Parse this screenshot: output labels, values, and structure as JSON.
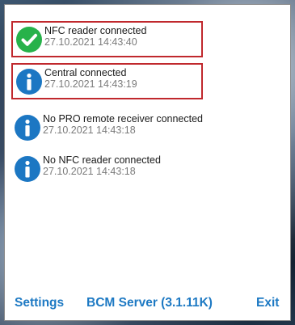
{
  "notifications": [
    {
      "icon": "check-circle-icon",
      "title": "NFC reader connected",
      "time": "27.10.2021 14:43:40",
      "highlighted": true,
      "color": "#27b24a"
    },
    {
      "icon": "info-circle-icon",
      "title": "Central connected",
      "time": "27.10.2021 14:43:19",
      "highlighted": true,
      "color": "#1c77c3"
    },
    {
      "icon": "info-circle-icon",
      "title": "No PRO remote receiver connected",
      "time": "27.10.2021 14:43:18",
      "highlighted": false,
      "color": "#1c77c3"
    },
    {
      "icon": "info-circle-icon",
      "title": "No NFC reader connected",
      "time": "27.10.2021 14:43:18",
      "highlighted": false,
      "color": "#1c77c3"
    }
  ],
  "footer": {
    "settings_label": "Settings",
    "server_label": "BCM Server (3.1.11K)",
    "exit_label": "Exit"
  },
  "colors": {
    "link": "#1d79c3",
    "highlight_border": "#c0282d"
  }
}
